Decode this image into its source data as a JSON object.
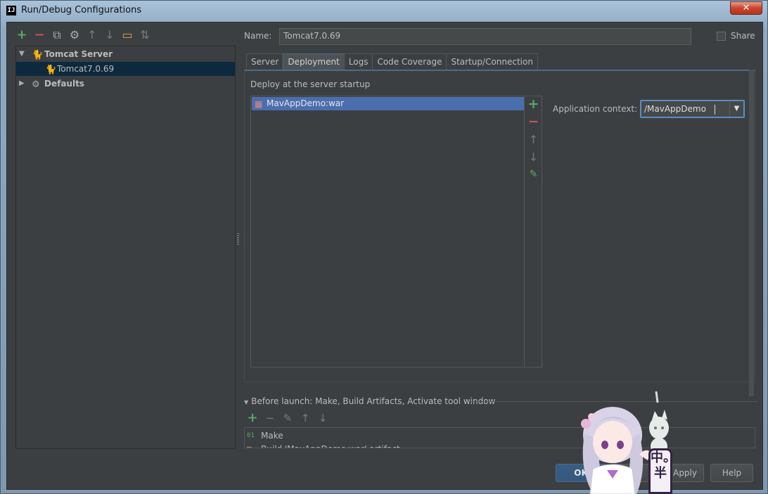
{
  "window": {
    "title": "Run/Debug Configurations",
    "close_label": "✕"
  },
  "toolbar": {
    "icons": [
      "add-icon",
      "remove-icon",
      "copy-icon",
      "edit-defaults-icon",
      "move-up-icon",
      "move-down-icon",
      "folder-icon",
      "sort-icon"
    ]
  },
  "tree": {
    "group": {
      "label": "Tomcat Server",
      "expanded": true
    },
    "child": {
      "label": "Tomcat7.0.69",
      "selected": true
    },
    "defaults": {
      "label": "Defaults",
      "expanded": false
    }
  },
  "name": {
    "label": "Name:",
    "value": "Tomcat7.0.69"
  },
  "share": {
    "label": "Share",
    "checked": false
  },
  "tabs": [
    {
      "label": "Server",
      "active": false
    },
    {
      "label": "Deployment",
      "active": true
    },
    {
      "label": "Logs",
      "active": false
    },
    {
      "label": "Code Coverage",
      "active": false
    },
    {
      "label": "Startup/Connection",
      "active": false
    }
  ],
  "deployment": {
    "section_label": "Deploy at the server startup",
    "artifacts": [
      {
        "label": "MavAppDemo:war",
        "selected": true
      }
    ],
    "context_label": "Application context:",
    "context_value": "/MavAppDemo"
  },
  "before_launch": {
    "header": "Before launch: Make, Build Artifacts, Activate tool window",
    "items": [
      {
        "label": "Make",
        "icon": "make-icon"
      },
      {
        "label": "Build 'MavAppDemo:war' artifact",
        "icon": "artifact-icon"
      }
    ]
  },
  "buttons": {
    "ok": "OK",
    "cancel": "",
    "apply": "Apply",
    "help": "Help"
  },
  "overlay": {
    "sticker_text": "中。半"
  },
  "colors": {
    "background": "#3c3f41",
    "selection": "#4b6eaf",
    "tree_selection": "#0d293e",
    "focus": "#5b8cc4",
    "add": "#59a869",
    "remove": "#c75450"
  }
}
